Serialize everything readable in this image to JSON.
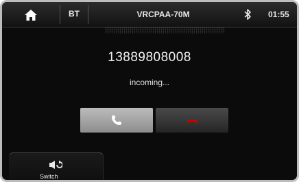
{
  "header": {
    "source": "BT",
    "device_name": "VRCPAA-70M",
    "time": "01:55",
    "icons": [
      "home-icon",
      "bluetooth-icon"
    ]
  },
  "call": {
    "number": "13889808008",
    "status": "incoming..."
  },
  "actions": {
    "answer_icon": "phone-answer-icon",
    "reject_icon": "phone-hangup-icon"
  },
  "bottom": {
    "switch_label": "Switch",
    "switch_icon": "switch-audio-icon"
  },
  "colors": {
    "background": "#0b0b0b",
    "answer_button": "#a8a8a8",
    "reject_button": "#333333",
    "text": "#f2f2f2"
  }
}
